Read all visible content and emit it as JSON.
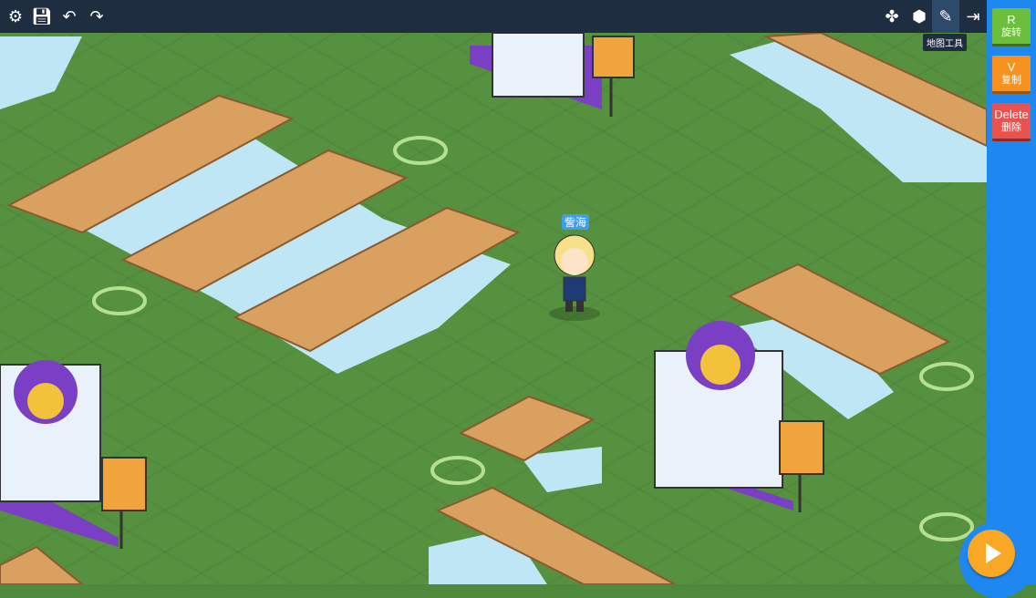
{
  "toolbar": {
    "left": [
      "gear-icon",
      "save-icon",
      "undo-icon",
      "redo-icon"
    ],
    "right": [
      "grid-icon",
      "cube-icon",
      "map-tool-icon",
      "exit-icon"
    ],
    "tooltip": "地图工具"
  },
  "panel": {
    "rotate": {
      "key": "R",
      "label": "旋转"
    },
    "copy": {
      "key": "V",
      "label": "复制"
    },
    "delete": {
      "key": "Delete",
      "label": "删除"
    }
  },
  "player": {
    "name": "訾海"
  },
  "colors": {
    "topbar": "#1f2d40",
    "panel": "#1e88f0",
    "grass": "#55913f",
    "rotate": "#6cbf3d",
    "copy": "#f7921e",
    "delete": "#e9534f",
    "play": "#f9a825"
  }
}
